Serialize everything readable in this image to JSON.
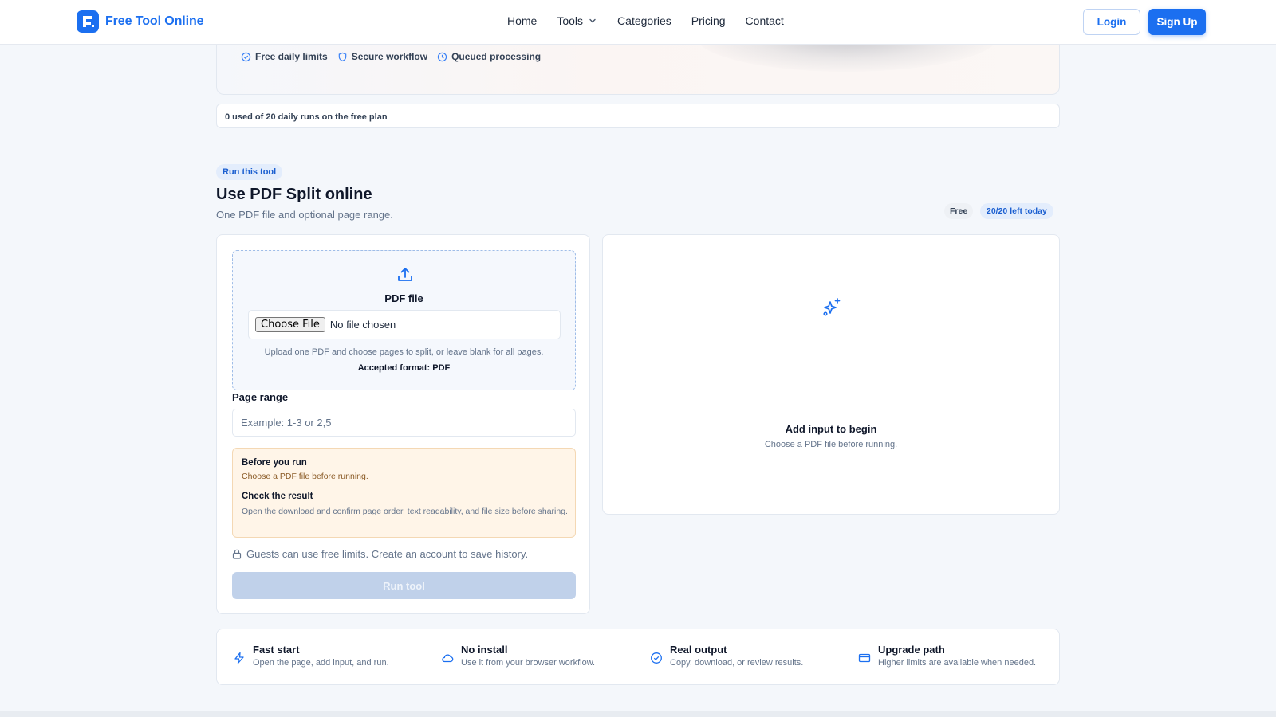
{
  "header": {
    "brand": "Free Tool Online",
    "nav": [
      {
        "label": "Home"
      },
      {
        "label": "Tools",
        "has_dropdown": true
      },
      {
        "label": "Categories"
      },
      {
        "label": "Pricing"
      },
      {
        "label": "Contact"
      }
    ],
    "login": "Login",
    "signup": "Sign Up"
  },
  "hero": {
    "badges": [
      {
        "label": "Free daily limits",
        "icon": "check-circle-icon"
      },
      {
        "label": "Secure workflow",
        "icon": "shield-icon"
      },
      {
        "label": "Queued processing",
        "icon": "clock-icon"
      }
    ]
  },
  "usage": {
    "text": "0 used of 20 daily runs on the free plan"
  },
  "tool": {
    "pill": "Run this tool",
    "title": "Use PDF Split online",
    "subtitle": "One PDF file and optional page range.",
    "tag_free": "Free",
    "tag_left": "20/20 left today"
  },
  "form": {
    "dropzone_title": "PDF file",
    "choose_file": "Choose File",
    "no_file": "No file chosen",
    "help": "Upload one PDF and choose pages to split, or leave blank for all pages.",
    "format": "Accepted format: PDF",
    "range_label": "Page range",
    "range_placeholder": "Example: 1-3 or 2,5",
    "range_value": "",
    "note": {
      "h1": "Before you run",
      "p1": "Choose a PDF file before running.",
      "h2": "Check the result",
      "p2": "Open the download and confirm page order, text readability, and file size before sharing."
    },
    "guest": "Guests can use free limits. Create an account to save history.",
    "run": "Run tool"
  },
  "output": {
    "title": "Add input to begin",
    "sub": "Choose a PDF file before running."
  },
  "features": [
    {
      "title": "Fast start",
      "sub": "Open the page, add input, and run.",
      "icon": "bolt-icon"
    },
    {
      "title": "No install",
      "sub": "Use it from your browser workflow.",
      "icon": "cloud-icon"
    },
    {
      "title": "Real output",
      "sub": "Copy, download, or review results.",
      "icon": "check-circle-icon"
    },
    {
      "title": "Upgrade path",
      "sub": "Higher limits are available when needed.",
      "icon": "card-icon"
    }
  ],
  "colors": {
    "accent": "#1b6ff0",
    "pill_bg": "#e3edfc",
    "note_bg": "#fff5e8",
    "run_disabled": "#c0d1ea"
  }
}
